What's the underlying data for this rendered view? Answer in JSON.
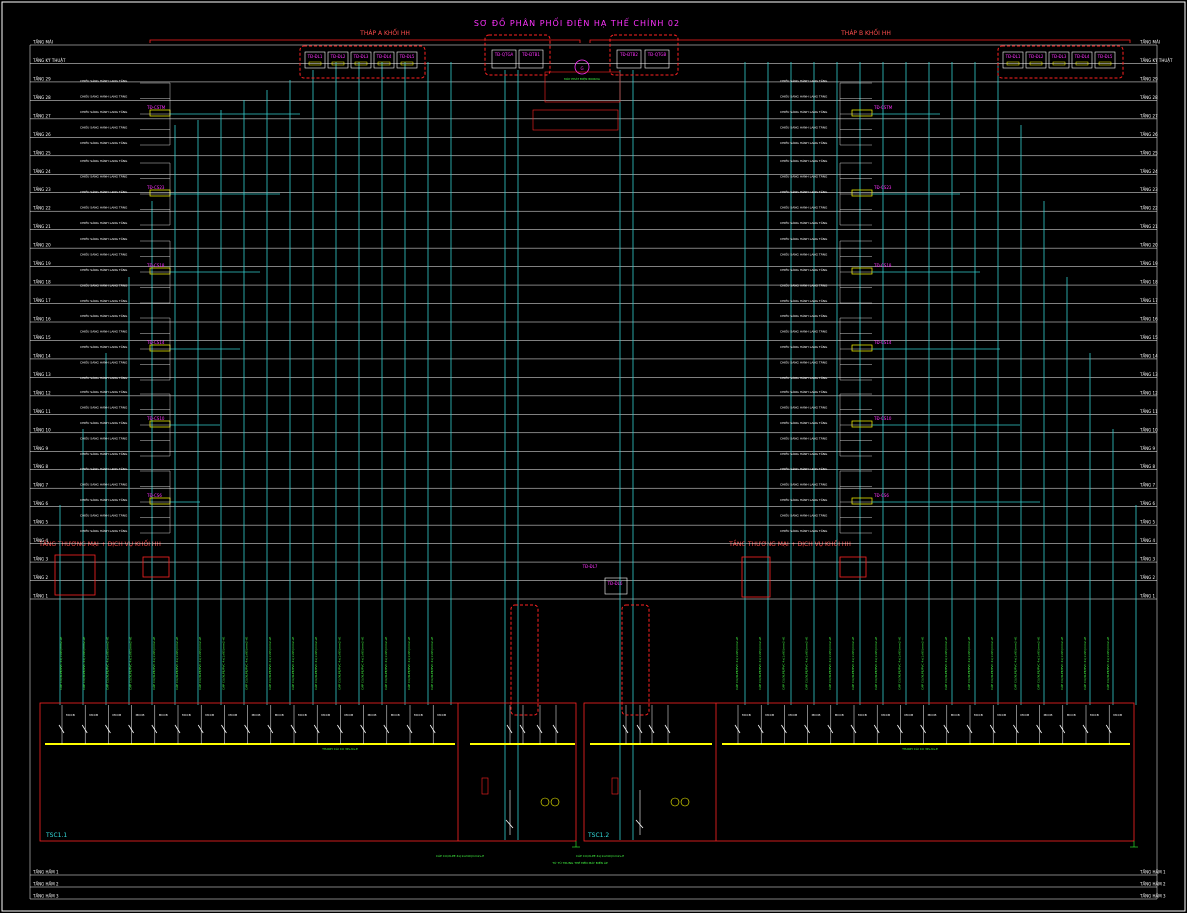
{
  "drawing": {
    "title": "SƠ ĐỒ PHÂN PHỐI ĐIỆN HẠ THẾ CHÍNH 02",
    "tower_a_label": "THÁP A KHỐI HH",
    "tower_b_label": "THÁP B KHỐI HH",
    "commercial_a_label": "TẦNG THƯƠNG MẠI + DỊCH VỤ KHỐI HH",
    "commercial_b_label": "TẦNG THƯƠNG MẠI + DỊCH VỤ KHỐI HH",
    "panel_a_label": "TSC1.1",
    "panel_b_label": "TSC1.2"
  },
  "floors_left": [
    "TẦNG MÁI",
    "TẦNG KỸ THUẬT",
    "TẦNG 29",
    "TẦNG 28",
    "TẦNG 27",
    "TẦNG 26",
    "TẦNG 25",
    "TẦNG 24",
    "TẦNG 23",
    "TẦNG 22",
    "TẦNG 21",
    "TẦNG 20",
    "TẦNG 19",
    "TẦNG 18",
    "TẦNG 17",
    "TẦNG 16",
    "TẦNG 15",
    "TẦNG 14",
    "TẦNG 13",
    "TẦNG 12",
    "TẦNG 11",
    "TẦNG 10",
    "TẦNG 9",
    "TẦNG 8",
    "TẦNG 7",
    "TẦNG 6",
    "TẦNG 5",
    "TẦNG 4",
    "TẦNG 3",
    "TẦNG 2",
    "TẦNG 1"
  ],
  "floors_right": [
    "TẦNG MÁI",
    "TẦNG KỸ THUẬT",
    "TẦNG 29",
    "TẦNG 28",
    "TẦNG 27",
    "TẦNG 26",
    "TẦNG 25",
    "TẦNG 24",
    "TẦNG 23",
    "TẦNG 22",
    "TẦNG 21",
    "TẦNG 20",
    "TẦNG 19",
    "TẦNG 18",
    "TẦNG 17",
    "TẦNG 16",
    "TẦNG 15",
    "TẦNG 14",
    "TẦNG 13",
    "TẦNG 12",
    "TẦNG 11",
    "TẦNG 10",
    "TẦNG 9",
    "TẦNG 8",
    "TẦNG 7",
    "TẦNG 6",
    "TẦNG 5",
    "TẦNG 4",
    "TẦNG 3",
    "TẦNG 2",
    "TẦNG 1"
  ],
  "basement_floors": [
    "TẦNG HẦM 1",
    "TẦNG HẦM 2",
    "TẦNG HẦM 3"
  ],
  "floor_feed_label": "CHIẾU SÁNG HÀNH LANG TẦNG",
  "sub_board_left": [
    "TĐ-CSTM",
    "TĐ-CS23",
    "TĐ-CS18",
    "TĐ-CS14",
    "TĐ-CS10",
    "TĐ-CS6"
  ],
  "sub_board_right": [
    "TĐ-CSTM",
    "TĐ-CS23",
    "TĐ-CS18",
    "TĐ-CS14",
    "TĐ-CS10",
    "TĐ-CS6"
  ],
  "top_boxes_left": [
    "TĐ-ĐL1",
    "TĐ-ĐL2",
    "TĐ-ĐL3",
    "TĐ-ĐL4",
    "TĐ-ĐL5"
  ],
  "top_boxes_right": [
    "TĐ-ĐL1",
    "TĐ-ĐL2",
    "TĐ-ĐL3",
    "TĐ-ĐL4",
    "TĐ-ĐL5"
  ],
  "top_center_boxes": [
    "TĐ-QTGA",
    "TĐ-ĐTB1",
    "TĐ-ĐTB2",
    "TĐ-QTGB"
  ],
  "generator_label": "G",
  "generator_note": "MÁY PHÁT ĐIỆN 800KVA",
  "feeder_label": "CÁP CU/XLPE/PVC 4x(1x95)mm2+E",
  "busbar_label": "THANH CÁI CU 3P+N+E",
  "breaker_label": "MCCB",
  "bottom_cable_label": "CÁP CU/XLPE 4x(1x240)mm2+E",
  "center_panel_a": "TĐ-ĐL6",
  "center_panel_b": "TĐ-ĐL7",
  "bottom_note": "TỪ TỦ TRUNG THẾ ĐẾN MÁY BIẾN ÁP"
}
